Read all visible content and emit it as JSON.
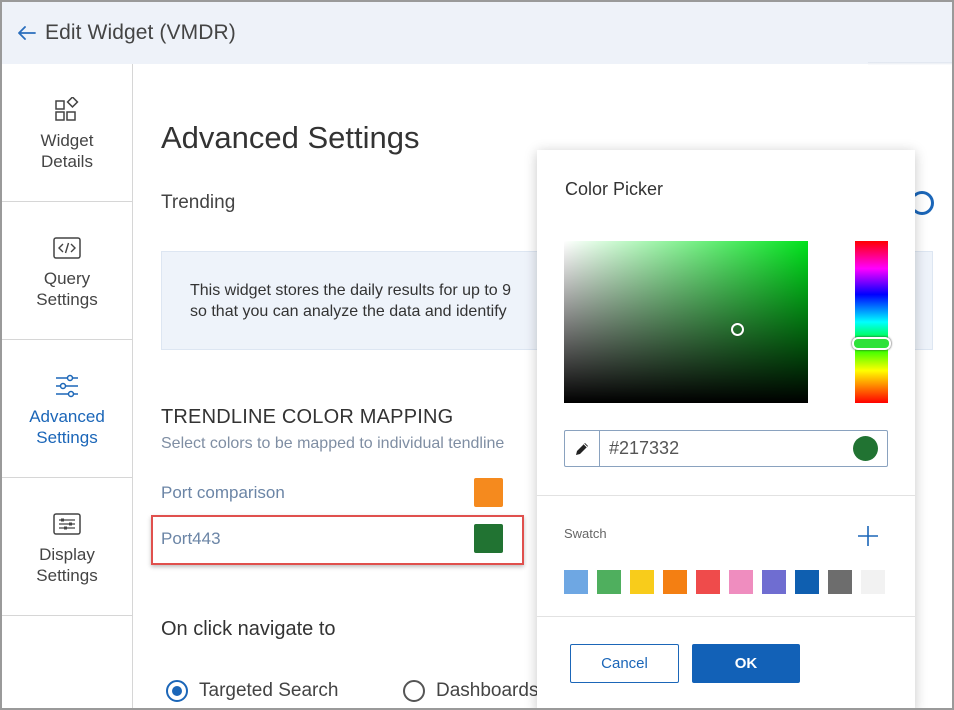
{
  "colors": {
    "accent": "#1b66b8",
    "header_bg": "#eef2f9",
    "highlight": "#e0504d"
  },
  "header": {
    "back_icon": "arrow-left-icon",
    "title": "Edit Widget (VMDR)"
  },
  "sidebar": {
    "items": [
      {
        "label": "Widget\nDetails",
        "icon": "widget-shapes-icon",
        "active": false
      },
      {
        "label": "Query\nSettings",
        "icon": "code-icon",
        "active": false
      },
      {
        "label": "Advanced\nSettings",
        "icon": "sliders-icon",
        "active": true
      },
      {
        "label": "Display\nSettings",
        "icon": "display-list-icon",
        "active": false
      }
    ]
  },
  "main": {
    "title": "Advanced Settings",
    "trending_label": "Trending",
    "info_line1": "This widget stores the daily results for up to 9",
    "info_line2": "so that you can analyze the data and identify",
    "trendline_heading": "TRENDLINE COLOR MAPPING",
    "trendline_sub": "Select colors to be mapped to individual tendline",
    "mappings": [
      {
        "label": "Port comparison",
        "color": "#f58a1e"
      },
      {
        "label": "Port443",
        "color": "#217332"
      }
    ],
    "navigate_heading": "On click navigate to",
    "radios": [
      {
        "label": "Targeted Search",
        "checked": true
      },
      {
        "label": "Dashboards",
        "checked": false
      }
    ]
  },
  "picker": {
    "title": "Color Picker",
    "hex_value": "#217332",
    "selected_color": "#217332",
    "swatch_label": "Swatch",
    "swatches": [
      "#6ea7e3",
      "#4faf5e",
      "#f8cc1b",
      "#f47f12",
      "#ef4b4b",
      "#ef8dbf",
      "#6f6dd1",
      "#0f5fb0",
      "#6d6d6d",
      "#f2f2f2"
    ],
    "cancel_label": "Cancel",
    "ok_label": "OK"
  }
}
